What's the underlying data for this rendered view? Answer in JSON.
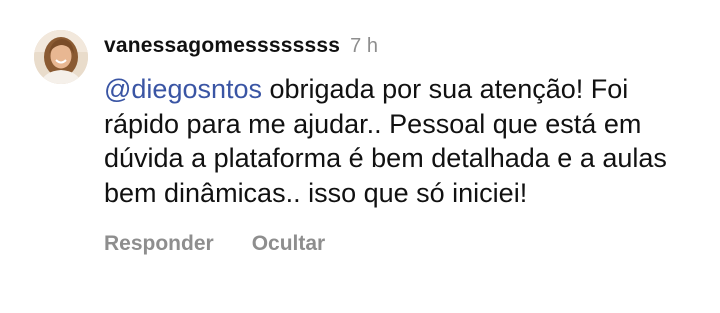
{
  "comment": {
    "username": "vanessagomessssssss",
    "time": "7 h",
    "mention": "@diegosntos",
    "text": " obrigada por sua atenção! Foi rápido para me ajudar.. Pessoal que está em dúvida a plataforma é bem detalhada e a aulas bem dinâmicas.. isso que só iniciei!",
    "avatar_icon": "user-avatar-photo"
  },
  "actions": {
    "reply_label": "Responder",
    "hide_label": "Ocultar"
  },
  "colors": {
    "mention": "#3a55a4",
    "muted": "#8e8e8e",
    "text": "#111111"
  }
}
